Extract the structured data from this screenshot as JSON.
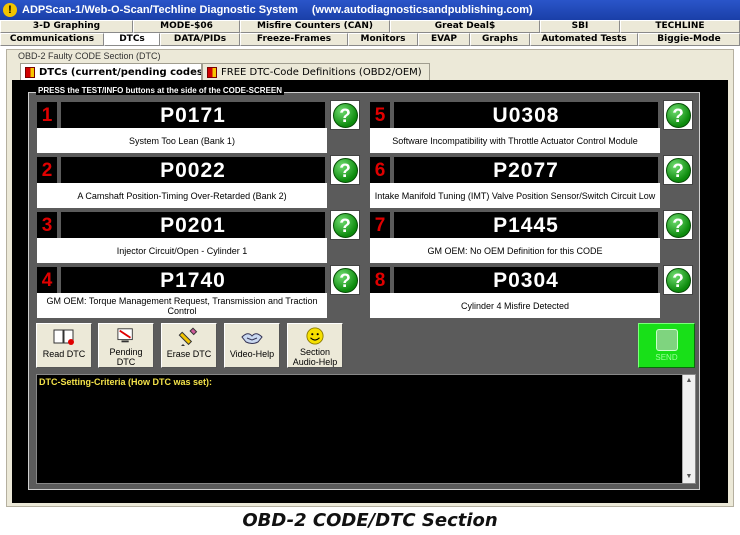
{
  "window": {
    "title": "ADPScan-1/Web-O-Scan/Techline Diagnostic System",
    "url": "(www.autodiagnosticsandpublishing.com)"
  },
  "tabs_row1": [
    "3-D Graphing",
    "MODE-$06",
    "Misfire Counters (CAN)",
    "Great Deal$",
    "SBI",
    "TECHLINE"
  ],
  "tabs_row2": [
    "Communications",
    "DTCs",
    "DATA/PIDs",
    "Freeze-Frames",
    "Monitors",
    "EVAP",
    "Graphs",
    "Automated Tests",
    "Biggie-Mode"
  ],
  "frame_legend": "OBD-2 Faulty CODE Section (DTC)",
  "subtabs": [
    "DTCs (current/pending codes)",
    "FREE DTC-Code Definitions (OBD2/OEM)"
  ],
  "panel_legend": "PRESS the TEST/INFO buttons at the side of the CODE-SCREEN",
  "slots": [
    {
      "num": "1",
      "code": "P0171",
      "desc": "System Too Lean (Bank 1)"
    },
    {
      "num": "2",
      "code": "P0022",
      "desc": "A Camshaft Position-Timing Over-Retarded (Bank 2)"
    },
    {
      "num": "3",
      "code": "P0201",
      "desc": "Injector Circuit/Open - Cylinder 1"
    },
    {
      "num": "4",
      "code": "P1740",
      "desc": "GM OEM: Torque Management Request, Transmission and Traction Control"
    },
    {
      "num": "5",
      "code": "U0308",
      "desc": "Software Incompatibility with Throttle Actuator Control Module"
    },
    {
      "num": "6",
      "code": "P2077",
      "desc": "Intake Manifold Tuning (IMT) Valve Position Sensor/Switch Circuit Low"
    },
    {
      "num": "7",
      "code": "P1445",
      "desc": "GM OEM: No OEM Definition for this CODE"
    },
    {
      "num": "8",
      "code": "P0304",
      "desc": "Cylinder 4 Misfire Detected"
    }
  ],
  "help_glyph": "?",
  "toolbar": {
    "read_dtc": "Read DTC",
    "pending_dtc": "Pending DTC",
    "erase_dtc": "Erase DTC",
    "video_help": "Video-Help",
    "audio_help": "Section Audio-Help",
    "send": "SEND"
  },
  "criteria_label": "DTC-Setting-Criteria (How DTC was set):",
  "caption": "OBD-2 CODE/DTC Section",
  "colors": {
    "title_bar": "#1a3fa8",
    "panel": "#5b5b5b",
    "slot_number": "#e00000",
    "criteria_text": "#f4e34a",
    "send_button": "#18e018"
  }
}
